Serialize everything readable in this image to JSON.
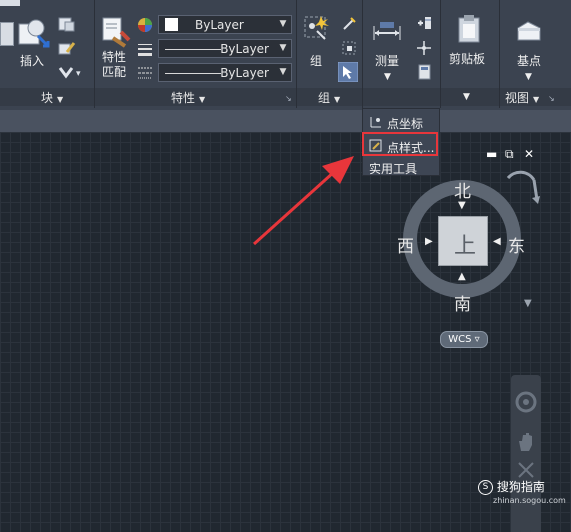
{
  "ribbon": {
    "insert_label": "插入",
    "block_panel": "块",
    "match_props_label": "特性\n匹配",
    "properties_panel": "特性",
    "group_label": "组",
    "group_panel": "组",
    "measure_label": "测量",
    "clipboard_label": "剪贴板",
    "basepoint_label": "基点",
    "view_panel": "视图",
    "bylayer_color": "ByLayer",
    "bylayer_linetype": "ByLayer",
    "bylayer_lineweight": "ByLayer"
  },
  "dropdown": {
    "items": [
      "点坐标",
      "点样式...",
      "实用工具"
    ]
  },
  "viewcube": {
    "north": "北",
    "south": "南",
    "east": "东",
    "west": "西",
    "face": "上",
    "wcs": "WCS"
  },
  "watermark": {
    "brand": "搜狗指南",
    "url": "zhinan.sogou.com"
  },
  "colors": {
    "highlight": "#e8363b",
    "arrow": "#e8363b"
  }
}
